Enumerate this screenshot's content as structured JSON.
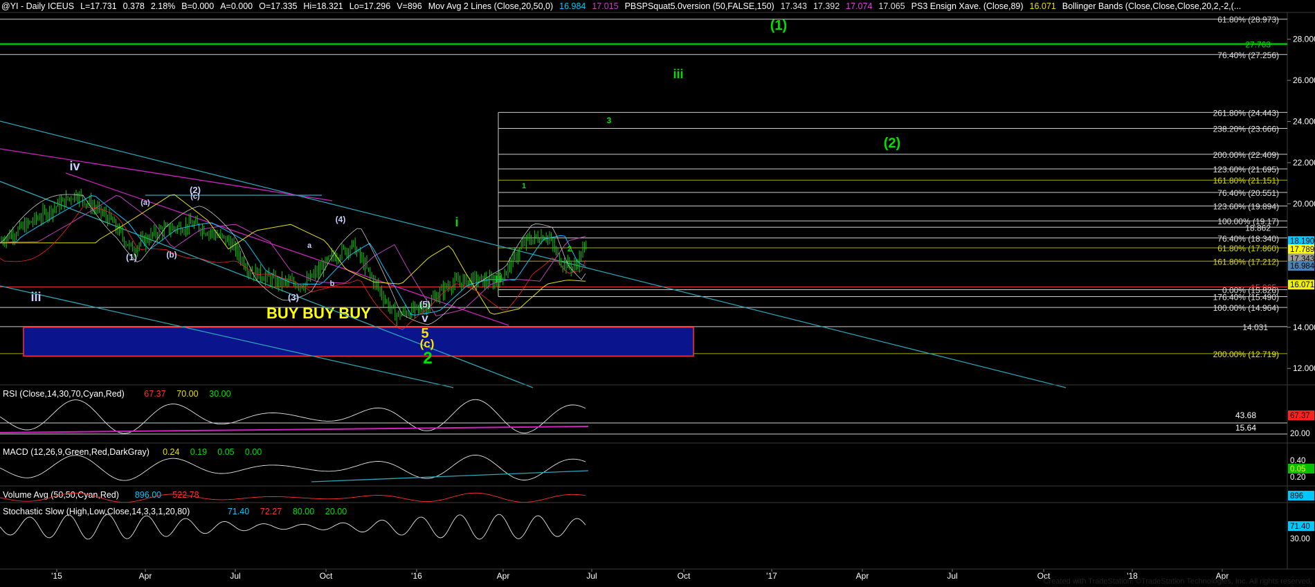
{
  "header": {
    "items": [
      {
        "t": "@YI - Daily  ICEUS",
        "c": "#ffffff"
      },
      {
        "t": "L=17.731",
        "c": "#ffffff"
      },
      {
        "t": "0.378",
        "c": "#ffffff"
      },
      {
        "t": "2.18%",
        "c": "#ffffff"
      },
      {
        "t": "B=0.000",
        "c": "#ffffff"
      },
      {
        "t": "A=0.000",
        "c": "#ffffff"
      },
      {
        "t": "O=17.335",
        "c": "#ffffff"
      },
      {
        "t": "Hi=18.321",
        "c": "#ffffff"
      },
      {
        "t": "Lo=17.296",
        "c": "#ffffff"
      },
      {
        "t": "V=896",
        "c": "#ffffff"
      },
      {
        "t": "Mov Avg 2 Lines (Close,20,50,0)",
        "c": "#ffffff"
      },
      {
        "t": "16.984",
        "c": "#00c8ff"
      },
      {
        "t": "17.015",
        "c": "#c040c0"
      },
      {
        "t": "PBSPSquat5.0version (50,FALSE,150)",
        "c": "#ffffff"
      },
      {
        "t": "17.343",
        "c": "#e0e0e0"
      },
      {
        "t": "17.392",
        "c": "#e0e0e0"
      },
      {
        "t": "17.074",
        "c": "#e040e0"
      },
      {
        "t": "17.065",
        "c": "#e0e0e0"
      },
      {
        "t": "PS3 Ensign Xave. (Close,89)",
        "c": "#ffffff"
      },
      {
        "t": "16.071",
        "c": "#e8e000"
      },
      {
        "t": "Bollinger Bands (Close,Close,Close,20,2,-2,(...",
        "c": "#ffffff"
      }
    ]
  },
  "footer": "Created with TradeStation. ©TradeStation Technologies, Inc. All rights reserved.",
  "chart_data": {
    "type": "line",
    "symbol": "@YI - Daily ICEUS",
    "x_ticks": [
      "'15",
      "Apr",
      "Jul",
      "Oct",
      "'16",
      "Apr",
      "Jul",
      "Oct",
      "'17",
      "Apr",
      "Jul",
      "Oct",
      "'18",
      "Apr"
    ],
    "price_axis": {
      "ticks": [
        "28.000",
        "26.000",
        "24.000",
        "22.000",
        "20.000",
        "14.000",
        "12.000"
      ],
      "ylim": [
        11.2,
        29.3
      ],
      "last_labels": [
        {
          "v": 18.19,
          "t": "18.190",
          "bg": "#00c8ff",
          "fg": "#000000"
        },
        {
          "v": 17.789,
          "t": "17.789",
          "bg": "#ffff00",
          "fg": "#000000"
        },
        {
          "v": 17.343,
          "t": "17.343",
          "bg": "#9a9a9a",
          "fg": "#000000"
        },
        {
          "v": 16.984,
          "t": "16.984",
          "bg": "#4a84b5",
          "fg": "#000000"
        },
        {
          "v": 16.071,
          "t": "16.071",
          "bg": "#f0f000",
          "fg": "#000000"
        }
      ]
    },
    "fib_levels": [
      {
        "v": 28.973,
        "t": "61.80% (28.973)",
        "c": "#d9d9d9"
      },
      {
        "v": 27.763,
        "t": "27.763",
        "c": "#00e000"
      },
      {
        "v": 27.256,
        "t": "76.40% (27.256)",
        "c": "#e0e0e0"
      },
      {
        "v": 24.443,
        "t": "261.80% (24.443)",
        "c": "#e0e0e0"
      },
      {
        "v": 23.666,
        "t": "238.20% (23.666)",
        "c": "#e0e0e0"
      },
      {
        "v": 22.409,
        "t": "200.00% (22.409)",
        "c": "#e0e0e0"
      },
      {
        "v": 21.695,
        "t": "123.60% (21.695)",
        "c": "#e0e0e0"
      },
      {
        "v": 21.151,
        "t": "161.80% (21.151)",
        "c": "#d8d800"
      },
      {
        "v": 20.551,
        "t": "76.40% (20.551)",
        "c": "#e0e0e0"
      },
      {
        "v": 19.894,
        "t": "123.60% (19.894)",
        "c": "#e0e0e0"
      },
      {
        "v": 19.17,
        "t": "100.00% (19.17)",
        "c": "#e0e0e0"
      },
      {
        "v": 18.862,
        "t": "18.862",
        "c": "#e0e0e0"
      },
      {
        "v": 18.34,
        "t": "76.40% (18.340)",
        "c": "#e0e0e0"
      },
      {
        "v": 17.86,
        "t": "61.80% (17.860)",
        "c": "#d8d800"
      },
      {
        "v": 17.212,
        "t": "161.80% (17.212)",
        "c": "#d8d800"
      },
      {
        "v": 15.965,
        "t": "15.965",
        "c": "#ff3030"
      },
      {
        "v": 15.826,
        "t": "0.00% (15.826)",
        "c": "#e0e0e0"
      },
      {
        "v": 15.49,
        "t": "176.40% (15.490)",
        "c": "#e0e0e0"
      },
      {
        "v": 14.964,
        "t": "100.00% (14.964)",
        "c": "#e0e0e0"
      },
      {
        "v": 14.031,
        "t": "14.031",
        "c": "#e0e0e0"
      },
      {
        "v": 12.719,
        "t": "200.00% (12.719)",
        "c": "#e8e800"
      }
    ],
    "wave_labels": [
      {
        "t": "(1)",
        "c": "#00e000",
        "s": 20
      },
      {
        "t": "iii",
        "c": "#00e000",
        "s": 18
      },
      {
        "t": "(2)",
        "c": "#00e000",
        "s": 20
      },
      {
        "t": "3",
        "c": "#00e000",
        "s": 12
      },
      {
        "t": "1",
        "c": "#00e000",
        "s": 11
      },
      {
        "t": "i",
        "c": "#00e000",
        "s": 18
      },
      {
        "t": "ii",
        "c": "#00e000",
        "s": 18
      },
      {
        "t": "2",
        "c": "#00e000",
        "s": 11
      },
      {
        "t": "iv",
        "c": "#c8d0ff",
        "s": 18
      },
      {
        "t": "(2)",
        "c": "#c8d0ff",
        "s": 13
      },
      {
        "t": "(c)",
        "c": "#c8d0ff",
        "s": 11
      },
      {
        "t": "(a)",
        "c": "#c8d0ff",
        "s": 11
      },
      {
        "t": "(b)",
        "c": "#c8d0ff",
        "s": 12
      },
      {
        "t": "(1)",
        "c": "#c8d0ff",
        "s": 13
      },
      {
        "t": "(4)",
        "c": "#c8d0ff",
        "s": 12
      },
      {
        "t": "a",
        "c": "#c8d0ff",
        "s": 11
      },
      {
        "t": "b",
        "c": "#c8d0ff",
        "s": 11
      },
      {
        "t": "(3)",
        "c": "#c8d0ff",
        "s": 13
      },
      {
        "t": "(5)",
        "c": "#c8d0ff",
        "s": 13
      },
      {
        "t": "v",
        "c": "#c8d0ff",
        "s": 17
      },
      {
        "t": "iii",
        "c": "#c8d0ff",
        "s": 18
      },
      {
        "t": "5",
        "c": "#ffe000",
        "s": 20
      },
      {
        "t": "(c)",
        "c": "#ffe000",
        "s": 17
      },
      {
        "t": "2",
        "c": "#00e000",
        "s": 24
      }
    ],
    "box": {
      "label": "BUY BUY BUY",
      "fill": "#0a148c",
      "border": "#ff3030",
      "v_top": 14.0,
      "v_bottom": 12.6
    },
    "indicators": [
      {
        "name": "rsi",
        "title": "RSI (Close,14,30,70,Cyan,Red)",
        "values": [
          {
            "t": "67.37",
            "c": "#ff3030"
          },
          {
            "t": "70.00",
            "c": "#e8e000"
          },
          {
            "t": "30.00",
            "c": "#00e000"
          }
        ],
        "axis_labels": [
          {
            "t": "67.37",
            "bg": "#ff2020",
            "fg": "#000000"
          },
          {
            "t": "20.00",
            "bg": null,
            "fg": "#ffffff"
          }
        ],
        "mid_labels": [
          "43.68",
          "15.64"
        ]
      },
      {
        "name": "macd",
        "title": "MACD (12,26,9,Green,Red,DarkGray)",
        "values": [
          {
            "t": "0.24",
            "c": "#e8e000"
          },
          {
            "t": "0.19",
            "c": "#00e000"
          },
          {
            "t": "0.05",
            "c": "#00e000"
          },
          {
            "t": "0.00",
            "c": "#00e000"
          }
        ],
        "axis_labels": [
          {
            "t": "0.40",
            "bg": null,
            "fg": "#ffffff"
          },
          {
            "t": "0.05",
            "bg": "#00c000",
            "fg": "#ffff00"
          },
          {
            "t": "0.20",
            "bg": null,
            "fg": "#ffffff"
          }
        ]
      },
      {
        "name": "volume",
        "title": "Volume Avg (50,50,Cyan,Red)",
        "values": [
          {
            "t": "896.00",
            "c": "#00c8ff"
          },
          {
            "t": "522.78",
            "c": "#ff3030"
          }
        ],
        "axis_labels": [
          {
            "t": "896",
            "bg": "#00c8ff",
            "fg": "#000000"
          }
        ]
      },
      {
        "name": "stoch",
        "title": "Stochastic Slow (High,Low,Close,14,3,3,1,20,80)",
        "values": [
          {
            "t": "71.40",
            "c": "#00c8ff"
          },
          {
            "t": "72.27",
            "c": "#ff3030"
          },
          {
            "t": "80.00",
            "c": "#00e000"
          },
          {
            "t": "20.00",
            "c": "#00e000"
          }
        ],
        "axis_labels": [
          {
            "t": "71.40",
            "bg": "#00c8ff",
            "fg": "#000000"
          },
          {
            "t": "30.00",
            "bg": null,
            "fg": "#ffffff"
          }
        ]
      }
    ]
  }
}
